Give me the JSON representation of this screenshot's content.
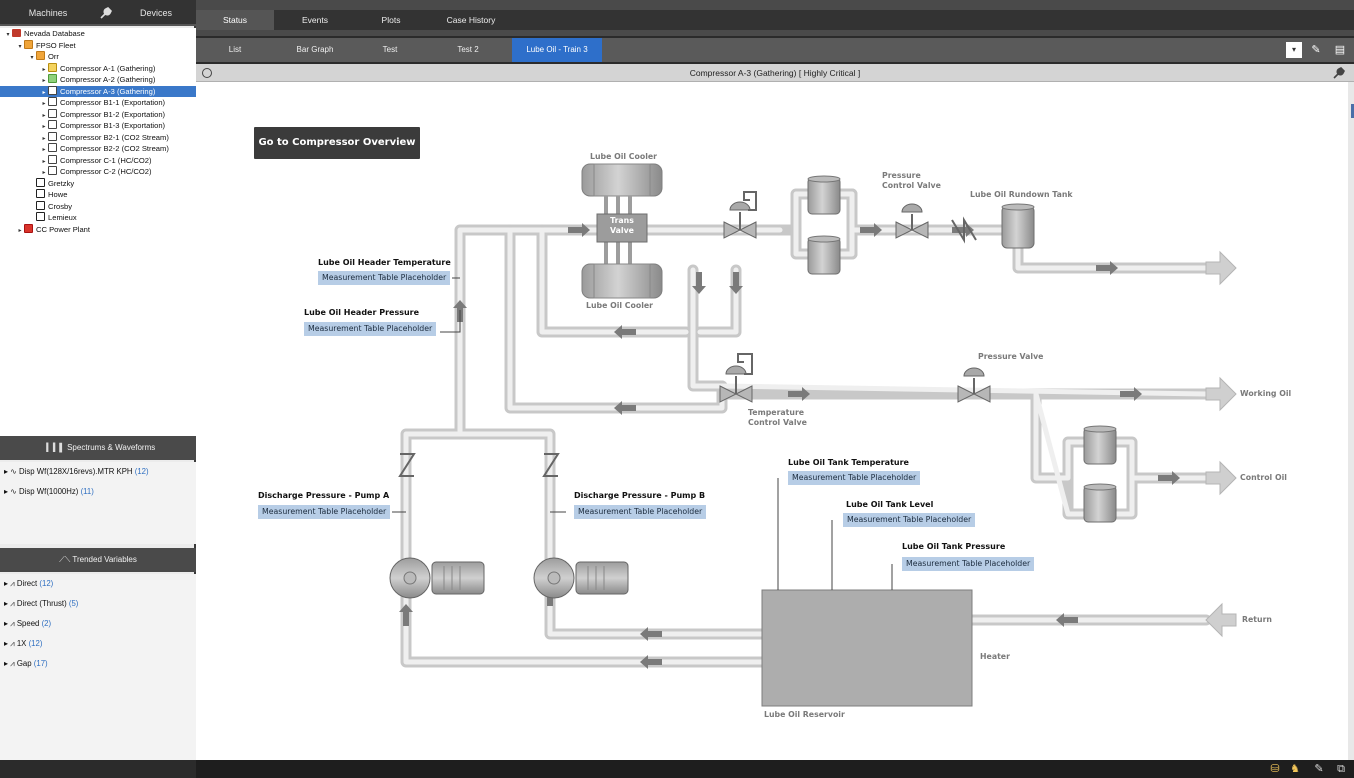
{
  "left_panel": {
    "tabs": {
      "machines": "Machines",
      "devices": "Devices"
    },
    "tree": [
      {
        "label": "Nevada Database",
        "level": 0,
        "toggle": "▾",
        "icon": "database-icon"
      },
      {
        "label": "FPSO Fleet",
        "level": 1,
        "toggle": "▾",
        "icon": "fleet-icon"
      },
      {
        "label": "Orr",
        "level": 2,
        "toggle": "▾",
        "icon": "fleet-icon"
      },
      {
        "label": "Compressor A-1 (Gathering)",
        "level": 3,
        "toggle": "▸",
        "icon": "machine-icon-yellow"
      },
      {
        "label": "Compressor A-2 (Gathering)",
        "level": 3,
        "toggle": "▸",
        "icon": "machine-icon-green"
      },
      {
        "label": "Compressor A-3 (Gathering)",
        "level": 3,
        "toggle": "▸",
        "icon": "machine-icon-selected",
        "selected": true
      },
      {
        "label": "Compressor B1-1 (Exportation)",
        "level": 3,
        "toggle": "▸",
        "icon": "machine-icon"
      },
      {
        "label": "Compressor B1-2 (Exportation)",
        "level": 3,
        "toggle": "▸",
        "icon": "machine-icon"
      },
      {
        "label": "Compressor B1-3 (Exportation)",
        "level": 3,
        "toggle": "▸",
        "icon": "machine-icon"
      },
      {
        "label": "Compressor B2-1 (CO2 Stream)",
        "level": 3,
        "toggle": "▸",
        "icon": "machine-icon"
      },
      {
        "label": "Compressor B2-2 (CO2 Stream)",
        "level": 3,
        "toggle": "▸",
        "icon": "machine-icon"
      },
      {
        "label": "Compressor C-1 (HC/CO2)",
        "level": 3,
        "toggle": "▸",
        "icon": "machine-icon"
      },
      {
        "label": "Compressor C-2 (HC/CO2)",
        "level": 3,
        "toggle": "▸",
        "icon": "machine-icon"
      },
      {
        "label": "Gretzky",
        "level": 2,
        "toggle": "",
        "icon": "grid-icon"
      },
      {
        "label": "Howe",
        "level": 2,
        "toggle": "",
        "icon": "grid-icon"
      },
      {
        "label": "Crosby",
        "level": 2,
        "toggle": "",
        "icon": "grid-icon"
      },
      {
        "label": "Lemieux",
        "level": 2,
        "toggle": "",
        "icon": "grid-icon"
      },
      {
        "label": "CC Power Plant",
        "level": 1,
        "toggle": "▸",
        "icon": "plant-icon"
      }
    ],
    "spectrums_header": "Spectrums & Waveforms",
    "spectrums": [
      {
        "label": "Disp Wf(128X/16revs).MTR KPH",
        "count": "(12)"
      },
      {
        "label": "Disp Wf(1000Hz)",
        "count": "(11)"
      }
    ],
    "trended_header": "Trended Variables",
    "trended": [
      {
        "label": "Direct",
        "count": "(12)"
      },
      {
        "label": "Direct (Thrust)",
        "count": "(5)"
      },
      {
        "label": "Speed",
        "count": "(2)"
      },
      {
        "label": "1X",
        "count": "(12)"
      },
      {
        "label": "Gap",
        "count": "(17)"
      }
    ]
  },
  "main_tabs": [
    "Status",
    "Events",
    "Plots",
    "Case History"
  ],
  "sub_tabs": [
    "List",
    "Bar Graph",
    "Test",
    "Test 2",
    "Lube Oil - Train 3"
  ],
  "view_title": "Compressor A-3 (Gathering) [ Highly Critical ]",
  "diagram": {
    "go_button": "Go to Compressor Overview",
    "placeholder": "Measurement Table Placeholder",
    "labels": {
      "lube_oil_cooler_top": "Lube Oil Cooler",
      "lube_oil_cooler_bottom": "Lube Oil Cooler",
      "trans_valve": "Trans\nValve",
      "pressure_control_valve": "Pressure\nControl Valve",
      "rundown_tank": "Lube Oil Rundown Tank",
      "header_temp": "Lube Oil Header Temperature",
      "header_pressure": "Lube Oil Header Pressure",
      "pressure_valve": "Pressure Valve",
      "working_oil": "Working Oil",
      "temp_control_valve": "Temperature\nControl Valve",
      "control_oil": "Control Oil",
      "tank_temp": "Lube Oil Tank Temperature",
      "tank_level": "Lube Oil Tank Level",
      "tank_pressure": "Lube Oil Tank Pressure",
      "discharge_a": "Discharge Pressure - Pump A",
      "discharge_b": "Discharge Pressure - Pump B",
      "return": "Return",
      "heater": "Heater",
      "reservoir": "Lube Oil Reservoir"
    }
  },
  "colors": {
    "selected": "#3a78c9",
    "active_tab": "#2e6fca",
    "placeholder_bg": "#b7cde6",
    "pipe": "#e4e4e4",
    "count": "#2f6fc1"
  }
}
